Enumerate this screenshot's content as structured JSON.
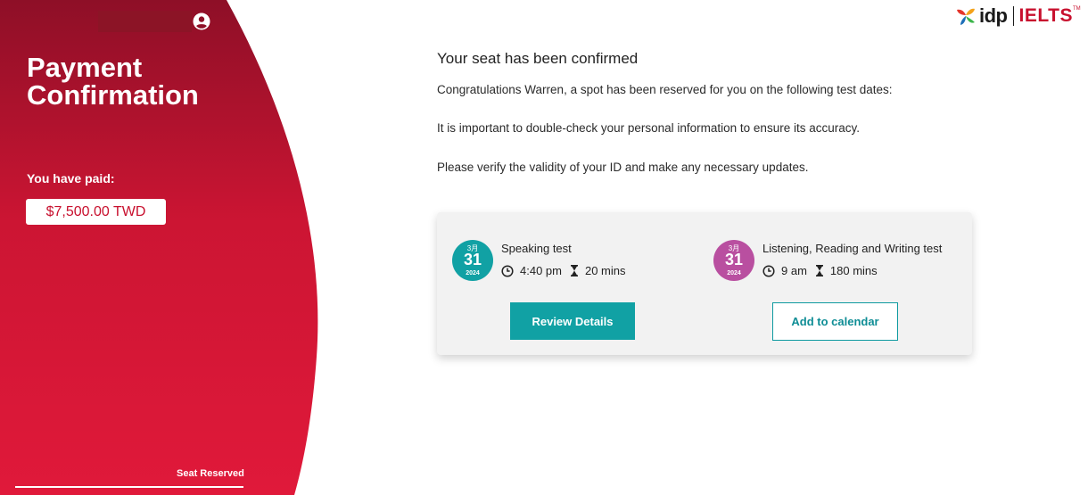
{
  "sidebar": {
    "title": "Payment Confirmation",
    "paid_label": "You have paid:",
    "amount": "$7,500.00 TWD",
    "step_label": "Seat Reserved",
    "colors": {
      "top": "#8e0f27",
      "bottom": "#e0193a"
    }
  },
  "header": {
    "logo_idp": "idp",
    "logo_ielts": "IELTS",
    "logo_tm": "TM"
  },
  "main": {
    "heading": "Your seat has been confirmed",
    "paragraphs": [
      "Congratulations Warren, a spot has been reserved for you on the following test dates:",
      "It is important to double-check your personal information to ensure its accuracy.",
      "Please verify the validity of your ID and make any necessary updates."
    ],
    "tests": [
      {
        "month": "3月",
        "day": "31",
        "year": "2024",
        "name": "Speaking test",
        "time": "4:40 pm",
        "duration": "20 mins",
        "color": "#11a1a4"
      },
      {
        "month": "3月",
        "day": "31",
        "year": "2024",
        "name": "Listening, Reading and Writing test",
        "time": "9 am",
        "duration": "180 mins",
        "color": "#b94fa0"
      }
    ],
    "buttons": {
      "review": "Review Details",
      "calendar": "Add to calendar"
    }
  }
}
